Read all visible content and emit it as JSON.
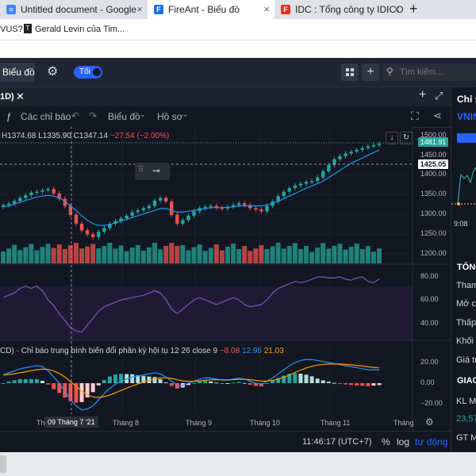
{
  "browser": {
    "tabs": [
      {
        "title": "Untitled document - Google",
        "favicon": "docs-icon",
        "color": "#4285f4",
        "active": false
      },
      {
        "title": "FireAnt - Biểu đồ",
        "favicon": "fireant-icon",
        "color": "#1a73e8",
        "active": true
      },
      {
        "title": "IDC : Tổng công ty IDICO - C",
        "favicon": "cafef-icon",
        "color": "#d93025",
        "active": false
      }
    ],
    "bookmarks": [
      {
        "label": "VUS?",
        "icon": ""
      },
      {
        "label": "Gerald Levin của Tim...",
        "icon": "bookmark-icon"
      }
    ]
  },
  "toolbar": {
    "chart_tab": "Biểu đồ",
    "toggle_label": "Tối",
    "search_placeholder": "Tìm kiếm..."
  },
  "chart_header": {
    "interval_label": "1D)"
  },
  "chart_toolbar": {
    "indicators_label": "Các chỉ báo",
    "chart_type_label": "Biểu đồ",
    "profile_label": "Hồ sơ"
  },
  "legend": {
    "high": "H1374.68",
    "low": "L1335.90",
    "close": "C1347.14",
    "change": "−27.54 (−2.00%)"
  },
  "price_axis": {
    "current_price": "1481.91",
    "crosshair_price": "1425.05",
    "labels": [
      "1500.00",
      "1450.00",
      "1400.00",
      "1350.00",
      "1300.00",
      "1250.00",
      "1200.00"
    ]
  },
  "rsi_axis": {
    "labels": [
      "80.00",
      "60.00",
      "40.00"
    ]
  },
  "macd": {
    "title": "CD) · Chỉ báo trung bình biến đổi phân kỳ hội tụ 12 26 close 9",
    "v1": "−8.08",
    "v2": "12.95",
    "v3": "21.03",
    "axis_labels": [
      "20.00",
      "0.00",
      "−20.00"
    ]
  },
  "time_axis": {
    "crosshair_date": "09 Tháng 7 '21",
    "months": [
      "Tháng 8",
      "Tháng 9",
      "Tháng 10",
      "Tháng 11",
      "Tháng"
    ],
    "partial_start": "Th"
  },
  "footer": {
    "time": "11:46:17 (UTC+7)",
    "percent": "%",
    "log": "log",
    "auto": "tự động"
  },
  "side_panel": {
    "title_partial": "Chỉ s",
    "symbol_partial": "VNIN",
    "mini_axis_label": "9:08",
    "rows": [
      "TỔNG",
      "Tham",
      "Mở cử",
      "Thấp",
      "Khối l",
      "Giá trị",
      "GIAO",
      "KL Mu",
      "23,57",
      "GT Mu"
    ]
  },
  "chart_data": {
    "type": "candlestick",
    "series": [
      {
        "name": "price",
        "values": [
          1342,
          1345,
          1351,
          1358,
          1364,
          1370,
          1372,
          1375,
          1378,
          1368,
          1356,
          1340,
          1320,
          1300,
          1285,
          1276,
          1270,
          1282,
          1290,
          1300,
          1306,
          1312,
          1318,
          1326,
          1330,
          1335,
          1340,
          1352,
          1358,
          1350,
          1320,
          1300,
          1308,
          1318,
          1328,
          1335,
          1338,
          1340,
          1336,
          1334,
          1338,
          1342,
          1346,
          1342,
          1335,
          1332,
          1328,
          1340,
          1350,
          1362,
          1372,
          1380,
          1386,
          1390,
          1394,
          1396,
          1404,
          1418,
          1432,
          1445,
          1452,
          1458,
          1462,
          1466,
          1470,
          1474,
          1477,
          1480
        ]
      },
      {
        "name": "ma",
        "values": [
          1338,
          1340,
          1344,
          1348,
          1352,
          1356,
          1360,
          1362,
          1364,
          1362,
          1358,
          1350,
          1340,
          1330,
          1318,
          1308,
          1300,
          1296,
          1296,
          1298,
          1302,
          1306,
          1310,
          1314,
          1318,
          1322,
          1326,
          1330,
          1334,
          1334,
          1330,
          1326,
          1326,
          1328,
          1330,
          1332,
          1334,
          1336,
          1336,
          1336,
          1337,
          1338,
          1340,
          1340,
          1340,
          1340,
          1340,
          1342,
          1346,
          1350,
          1356,
          1362,
          1368,
          1374,
          1380,
          1385,
          1390,
          1396,
          1404,
          1412,
          1420,
          1428,
          1436,
          1442,
          1448,
          1454,
          1460,
          1466
        ]
      },
      {
        "name": "rsi",
        "values": [
          62,
          64,
          66,
          70,
          72,
          70,
          72,
          68,
          60,
          55,
          48,
          42,
          36,
          33,
          32,
          38,
          44,
          50,
          54,
          56,
          58,
          60,
          61,
          62,
          63,
          64,
          66,
          68,
          66,
          60,
          52,
          48,
          52,
          56,
          60,
          62,
          60,
          58,
          56,
          58,
          60,
          62,
          60,
          56,
          54,
          55,
          56,
          60,
          66,
          70,
          72,
          74,
          76,
          75,
          76,
          78,
          80,
          80,
          79,
          79,
          80,
          78,
          77,
          79,
          80,
          76,
          75,
          78
        ]
      },
      {
        "name": "macd",
        "values": [
          8,
          10,
          12,
          14,
          15,
          16,
          17,
          16,
          12,
          6,
          0,
          -8,
          -16,
          -22,
          -26,
          -25,
          -22,
          -16,
          -10,
          -5,
          -1,
          2,
          4,
          6,
          7,
          8,
          9,
          10,
          9,
          6,
          2,
          -2,
          -2,
          0,
          2,
          4,
          5,
          5,
          4,
          3,
          3,
          4,
          5,
          4,
          2,
          0,
          -1,
          2,
          5,
          9,
          13,
          17,
          20,
          22,
          23,
          23,
          22,
          21,
          20,
          19,
          18,
          17,
          16,
          15,
          14,
          13,
          13,
          13
        ]
      }
    ]
  }
}
